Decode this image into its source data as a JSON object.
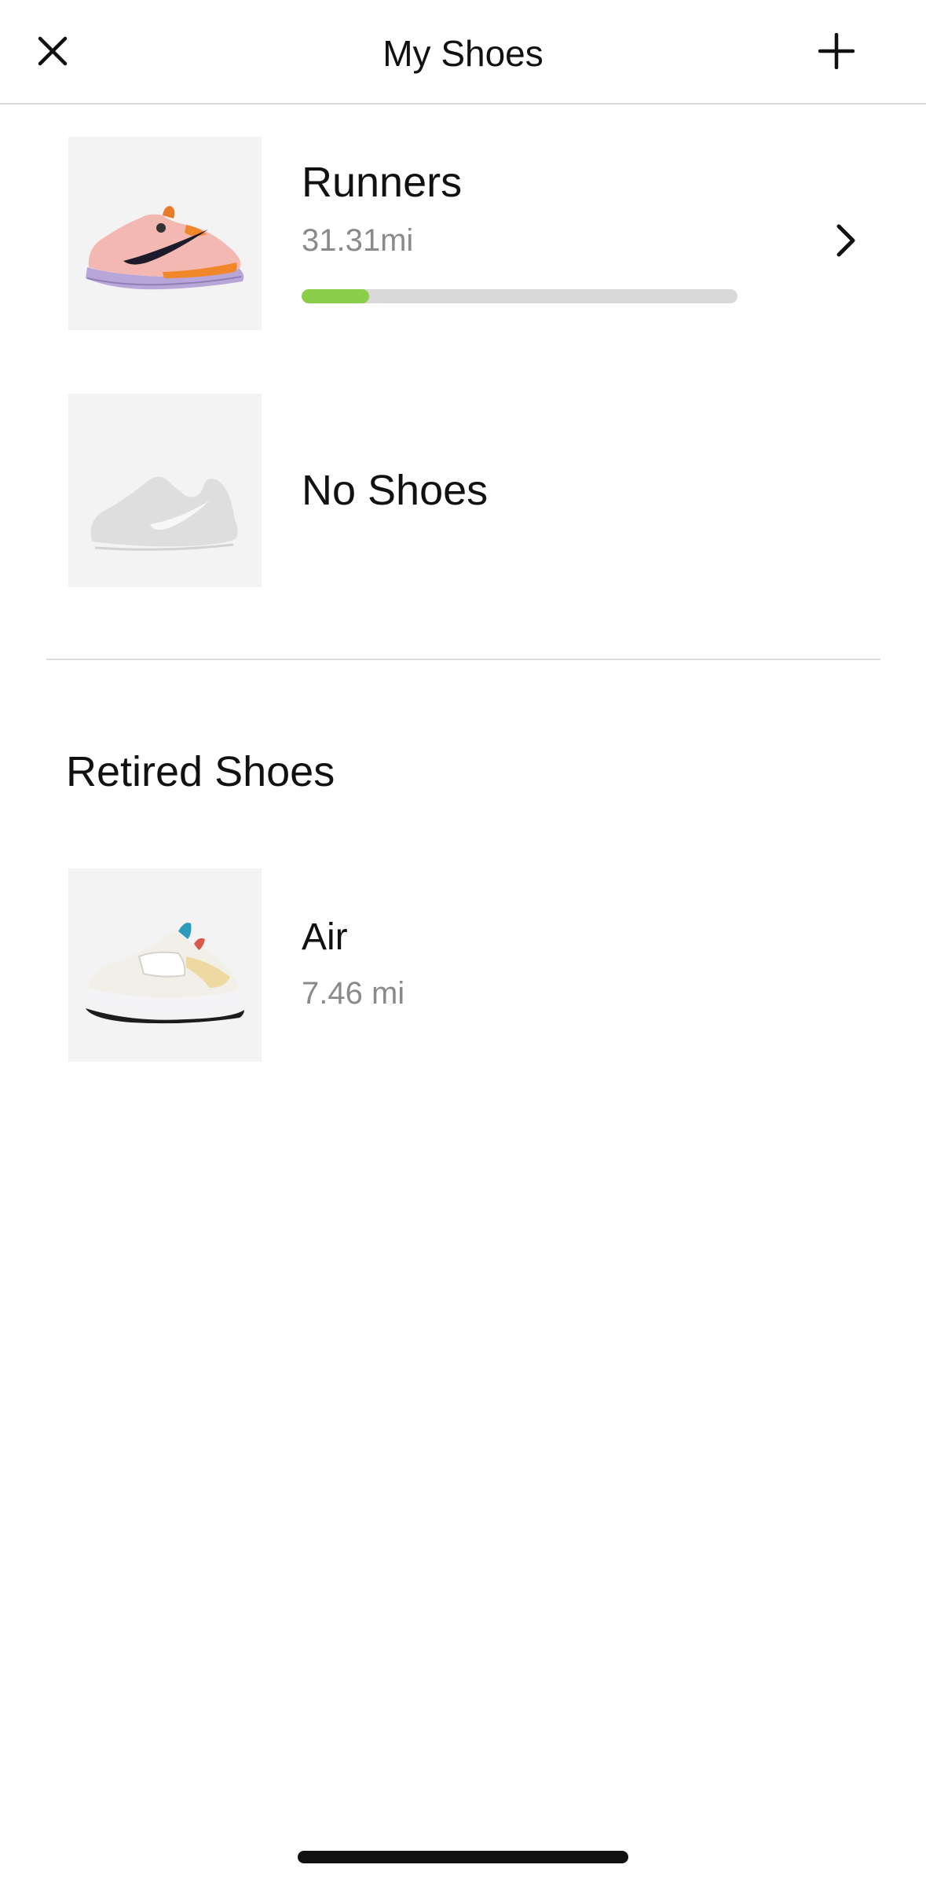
{
  "header": {
    "title": "My Shoes",
    "close_icon": "close-icon",
    "add_icon": "plus-icon"
  },
  "active_shoes": [
    {
      "name": "Runners",
      "distance": "31.31mi",
      "progress_fraction": 0.155,
      "progress_color": "#8bce4a",
      "track_color": "#d9d9d9",
      "icon": "chevron-right-icon"
    },
    {
      "name": "No Shoes"
    }
  ],
  "retired": {
    "title": "Retired Shoes",
    "shoes": [
      {
        "name": "Air",
        "distance": "7.46 mi"
      }
    ]
  }
}
